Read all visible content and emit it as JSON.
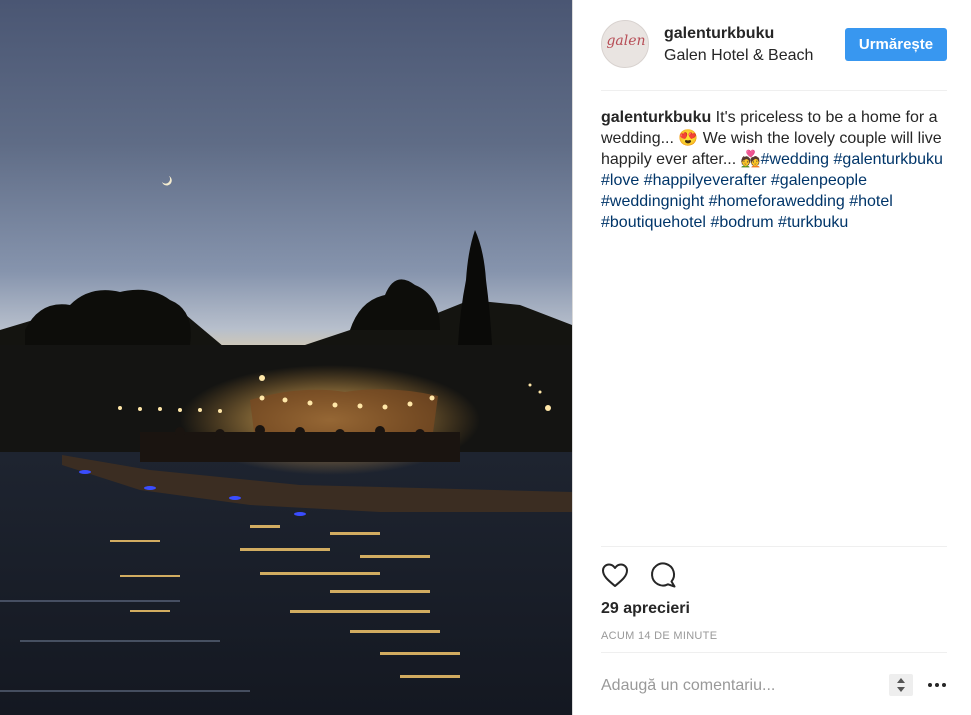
{
  "post": {
    "username": "galenturkbuku",
    "location": "Galen Hotel & Beach",
    "follow_label": "Urmărește",
    "avatar_logo_text": "galen",
    "caption": {
      "username": "galenturkbuku",
      "line1": " It's priceless to be a home for a wedding... ",
      "emoji1": "😍",
      "line2": " We wish the lovely couple will live happily ever after... ",
      "emoji2": "💑",
      "hashtags": [
        "#wedding",
        "#galenturkbuku",
        "#love",
        "#happilyeverafter",
        "#galenpeople",
        "#weddingnight",
        "#homeforawedding",
        "#hotel",
        "#boutiquehotel",
        "#bodrum",
        "#turkbuku"
      ]
    },
    "likes": "29 aprecieri",
    "time": "ACUM 14 DE MINUTE",
    "comment_placeholder": "Adaugă un comentariu..."
  },
  "icons": {
    "like": "heart-outline-icon",
    "comment": "speech-bubble-icon",
    "more": "ellipsis-icon",
    "resize": "up-down-arrows-icon"
  },
  "colors": {
    "follow_button": "#3897f0",
    "hashtag": "#003569",
    "secondary_text": "#999999"
  }
}
